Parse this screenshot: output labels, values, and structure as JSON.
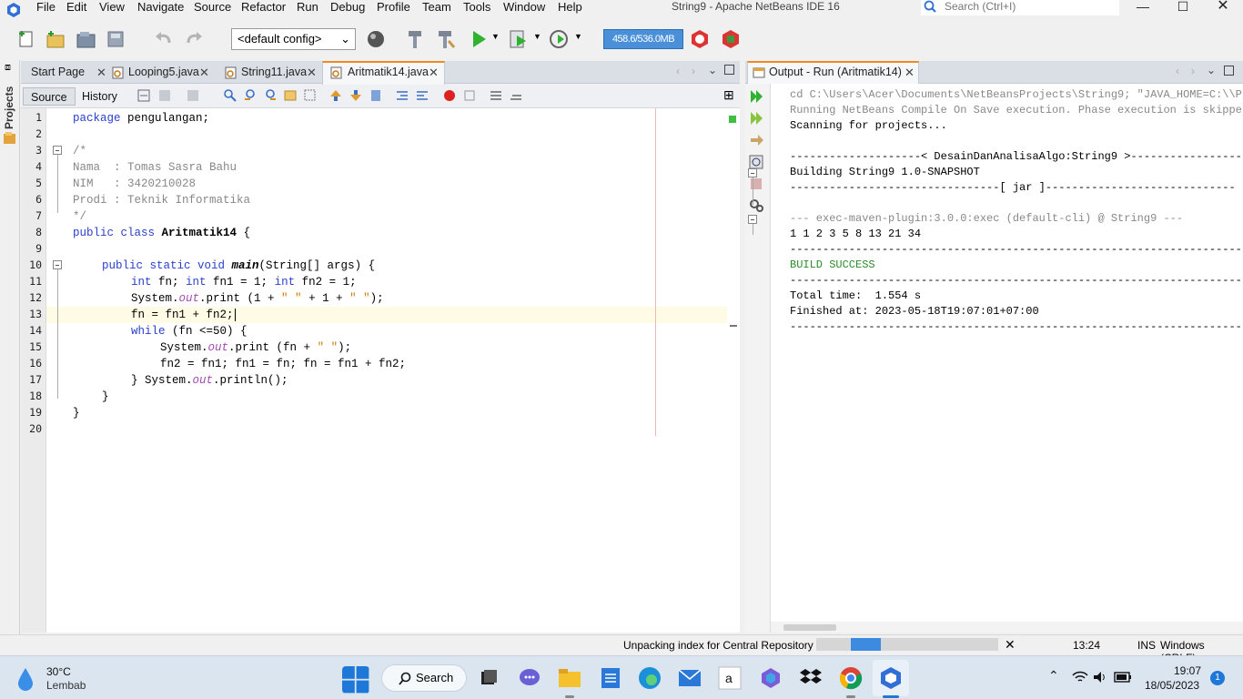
{
  "window": {
    "title": "String9 - Apache NetBeans IDE 16"
  },
  "menu": [
    "File",
    "Edit",
    "View",
    "Navigate",
    "Source",
    "Refactor",
    "Run",
    "Debug",
    "Profile",
    "Team",
    "Tools",
    "Window",
    "Help"
  ],
  "search": {
    "placeholder": "Search (Ctrl+I)"
  },
  "toolbar": {
    "config": "<default config>",
    "memory": "458.6/536.0MB"
  },
  "left_strip": {
    "projects_label": "Projects"
  },
  "editor_tabs": [
    {
      "label": "Start Page",
      "active": false
    },
    {
      "label": "Looping5.java",
      "active": false
    },
    {
      "label": "String11.java",
      "active": false
    },
    {
      "label": "Aritmatik14.java",
      "active": true
    }
  ],
  "editor": {
    "source_tab": "Source",
    "history_tab": "History",
    "line_numbers": [
      "1",
      "2",
      "3",
      "4",
      "5",
      "6",
      "7",
      "8",
      "9",
      "10",
      "11",
      "12",
      "13",
      "14",
      "15",
      "16",
      "17",
      "18",
      "19",
      "20"
    ],
    "lines": {
      "l1a": "package",
      "l1b": " pengulangan;",
      "l3": "/*",
      "l4": "Nama  : Tomas Sasra Bahu",
      "l5": "NIM   : 3420210028",
      "l6": "Prodi : Teknik Informatika",
      "l7": "*/",
      "l8a": "public class",
      "l8b": " Aritmatik14",
      "l8c": " {",
      "l10a": "public static void",
      "l10b": " main",
      "l10c": "(String[] args) {",
      "l11a": "int",
      "l11b": " fn; ",
      "l11c": "int",
      "l11d": " fn1 = 1; ",
      "l11e": "int",
      "l11f": " fn2 = 1;",
      "l12a": "System.",
      "l12b": "out",
      "l12c": ".print (1 + ",
      "l12d": "\" \"",
      "l12e": " + 1 + ",
      "l12f": "\" \"",
      "l12g": ");",
      "l13": "fn = fn1 + fn2;",
      "l14a": "while",
      "l14b": " (fn <=50) {",
      "l15a": "System.",
      "l15b": "out",
      "l15c": ".print (fn + ",
      "l15d": "\" \"",
      "l15e": ");",
      "l16": "fn2 = fn1; fn1 = fn; fn = fn1 + fn2;",
      "l17a": "} System.",
      "l17b": "out",
      "l17c": ".println();",
      "l18": "}",
      "l19": "}"
    }
  },
  "output": {
    "tab_label": "Output - Run (Aritmatik14)",
    "lines": [
      "cd C:\\Users\\Acer\\Documents\\NetBeansProjects\\String9; \"JAVA_HOME=C:\\\\P",
      "Running NetBeans Compile On Save execution. Phase execution is skippe",
      "Scanning for projects...",
      "",
      "--------------------< DesainDanAnalisaAlgo:String9 >-----------------",
      "Building String9 1.0-SNAPSHOT",
      "--------------------------------[ jar ]-----------------------------",
      "",
      "--- exec-maven-plugin:3.0.0:exec (default-cli) @ String9 ---",
      "1 1 2 3 5 8 13 21 34",
      "------------------------------------------------------------------------",
      "BUILD SUCCESS",
      "------------------------------------------------------------------------",
      "Total time:  1.554 s",
      "Finished at: 2023-05-18T19:07:01+07:00",
      "------------------------------------------------------------------------"
    ]
  },
  "status": {
    "task": "Unpacking index for Central Repository",
    "progress_fraction": 0.165,
    "position": "13:24",
    "mode": "INS",
    "line_ending": "Windows (CRLF)"
  },
  "taskbar": {
    "weather_temp": "30°C",
    "weather_desc": "Lembab",
    "search_label": "Search",
    "time": "19:07",
    "date": "18/05/2023",
    "notif_count": "1"
  },
  "colors": {
    "accent_tab": "#f08a24",
    "memory_bar": "#4a90d9",
    "build_success": "#2d8b2d",
    "keyword": "#2a3fcc"
  }
}
